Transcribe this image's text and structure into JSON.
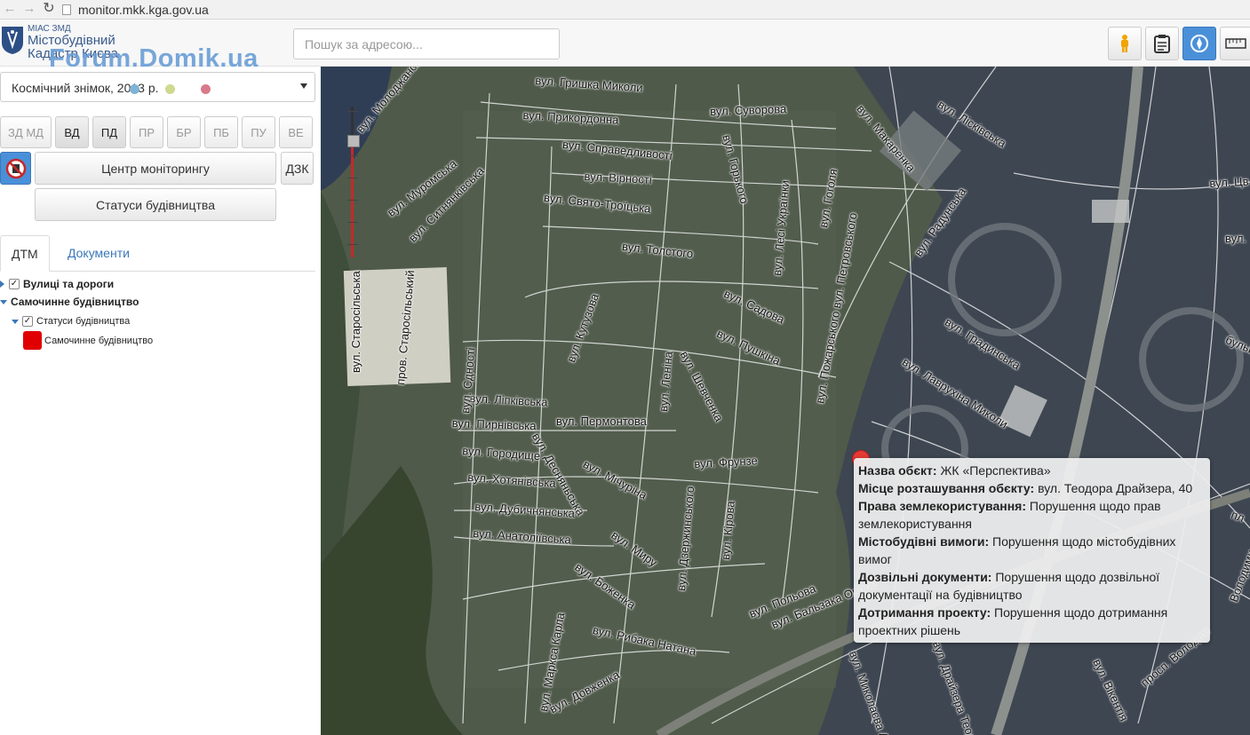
{
  "browser": {
    "url": "monitor.mkk.kga.gov.ua"
  },
  "header": {
    "logo_small": "МІАС ЗМД",
    "logo_line1": "Містобудівний",
    "logo_line2": "Кадастр Києва",
    "watermark": "Forum.Domik.ua",
    "search_placeholder": "Пошук за адресою...",
    "tools": [
      {
        "name": "pegman-icon",
        "active": false
      },
      {
        "name": "clipboard-icon",
        "active": false
      },
      {
        "name": "compass-icon",
        "active": true
      },
      {
        "name": "ruler-icon",
        "active": false
      }
    ]
  },
  "sidebar": {
    "layer_select": "Космічний знімок, 2013 р.",
    "dot_colors": [
      "#7fb3d5",
      "#cfd98f",
      "#d97a8a"
    ],
    "filters": [
      {
        "label": "ЗД МД",
        "on": false
      },
      {
        "label": "ВД",
        "on": true
      },
      {
        "label": "ПД",
        "on": true
      },
      {
        "label": "ПР",
        "on": false
      },
      {
        "label": "БР",
        "on": false
      },
      {
        "label": "ПБ",
        "on": false
      },
      {
        "label": "ПУ",
        "on": false
      },
      {
        "label": "ВЕ",
        "on": false
      }
    ],
    "monitoring_button": "Центр моніторингу",
    "dzk_button": "ДЗК",
    "statuses_button": "Статуси будівництва",
    "tabs": {
      "active": "ДТМ",
      "other": "Документи"
    },
    "tree": {
      "roads": "Вулиці та дороги",
      "illegal": "Самочинне будівництво",
      "statuses": "Статуси будівництва",
      "legend_item": "Самочинне будівництво",
      "legend_color": "#e00000"
    }
  },
  "map": {
    "streets": [
      "вул. Гришка Миколи",
      "вул. Прикордонна",
      "вул. Суворова",
      "вул. Справедливості",
      "вул. Вірності",
      "вул. Свято-Троїцька",
      "вул. Толстого",
      "вул. Садова",
      "вул. Пушкіна",
      "вул. Лісківська",
      "вул. Макаренка",
      "вул. Радунська",
      "вул. Градинська",
      "вул. Лаврухіна Миколи",
      "вул. Ліпківська",
      "вул. Пирнівська",
      "вул. Пермонтова",
      "вул. Городище",
      "вул. Хотянівська",
      "вул. Дубичнянська",
      "вул. Анатоліївська",
      "вул. Мічуріна",
      "вул. Фрунзе",
      "вул. Миру",
      "вул. Боженка",
      "вул. Рибака Натана",
      "вул. Довженка",
      "вул. Польова",
      "вул. Бальзака Оноре",
      "вул. Молоджанська",
      "вул. Муромська",
      "вул. Ситнянківська",
      "вул. Старосільська",
      "пров. Старосільський",
      "вул. Сдності",
      "вул. Кутузова",
      "вул. Леніна",
      "вул. Шевченка",
      "вул. Дзержинського",
      "вул. Кірова",
      "вул. Маркса Карла",
      "вул. Горького",
      "вул. Лесі Українки",
      "вул. Гоголя",
      "вул. Пожарського вул. Петровського",
      "вул. Десняньська",
      "вул. Цв",
      "вул. Миколаєва Ал",
      "вул. Драйзера Теодора",
      "вул. Вікентія",
      "просп. Володим",
      "бульв.",
      "вул.",
      "пл",
      "Володими"
    ],
    "popup": {
      "rows": [
        {
          "key": "Назва обєкт:",
          "value": " ЖК «Перспектива»"
        },
        {
          "key": "Місце розташування обєкту:",
          "value": " вул. Теодора Драйзера, 40"
        },
        {
          "key": "Права землекористування:",
          "value": " Порушення щодо прав землекористування"
        },
        {
          "key": "Містобудівні вимоги:",
          "value": " Порушення щодо містобудівних вимог"
        },
        {
          "key": "Дозвільні документи:",
          "value": " Порушення щодо дозвільної документації на будівництво"
        },
        {
          "key": "Дотримання проекту:",
          "value": " Порушення щодо дотримання проектних рішень"
        }
      ]
    }
  }
}
